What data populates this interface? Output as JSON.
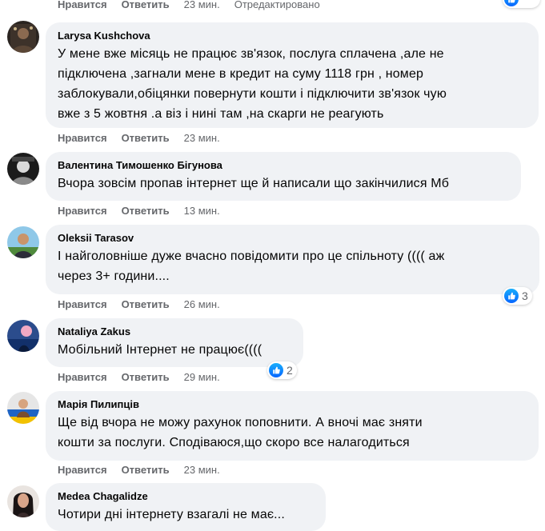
{
  "top_actions": {
    "like": "Нравится",
    "reply": "Ответить",
    "time": "23 мин.",
    "edited": "Отредактировано"
  },
  "comments": [
    {
      "author": "Larysa Kushchova",
      "text": "У мене вже місяць не працює зв'язок, послуга сплачена ,але не\nпідключена ,загнали мене в кредит на суму 1118 грн , номер\nзаблокували,обіцянки повернути кошти і підключити зв'язок чую\nвже з 5 жовтня .а віз і нині там ,на скарги не реагують",
      "like": "Нравится",
      "reply": "Ответить",
      "time": "23 мин."
    },
    {
      "author": "Валентина Тимошенко Бігунова",
      "text": "Вчора зовсім пропав інтернет ще й написали що закінчилися Мб",
      "like": "Нравится",
      "reply": "Ответить",
      "time": "13 мин."
    },
    {
      "author": "Oleksii Tarasov",
      "text": "І найголовніше дуже вчасно повідомити про це спільноту (((( аж\nчерез 3+ години....",
      "like": "Нравится",
      "reply": "Ответить",
      "time": "26 мин.",
      "reaction_count": "3"
    },
    {
      "author": "Nataliya Zakus",
      "text": "Мобільний Інтернет не працює((((",
      "like": "Нравится",
      "reply": "Ответить",
      "time": "29 мин.",
      "reaction_count": "2"
    },
    {
      "author": "Марія Пилипців",
      "text": "Ще від вчора не можу рахунок поповнити. А вночі має зняти\nкошти за послуги. Сподіваюся,що скоро все налагодиться",
      "like": "Нравится",
      "reply": "Ответить",
      "time": "23 мин."
    },
    {
      "author": "Medea Chagalidze",
      "text": "Чотири дні інтернету взагалі не має...",
      "like": "",
      "reply": "",
      "time": ""
    }
  ],
  "icons": {
    "reaction": "like-icon"
  },
  "colors": {
    "bubble": "#f0f2f5",
    "meta": "#65676b",
    "like_blue": "#0866ff"
  }
}
